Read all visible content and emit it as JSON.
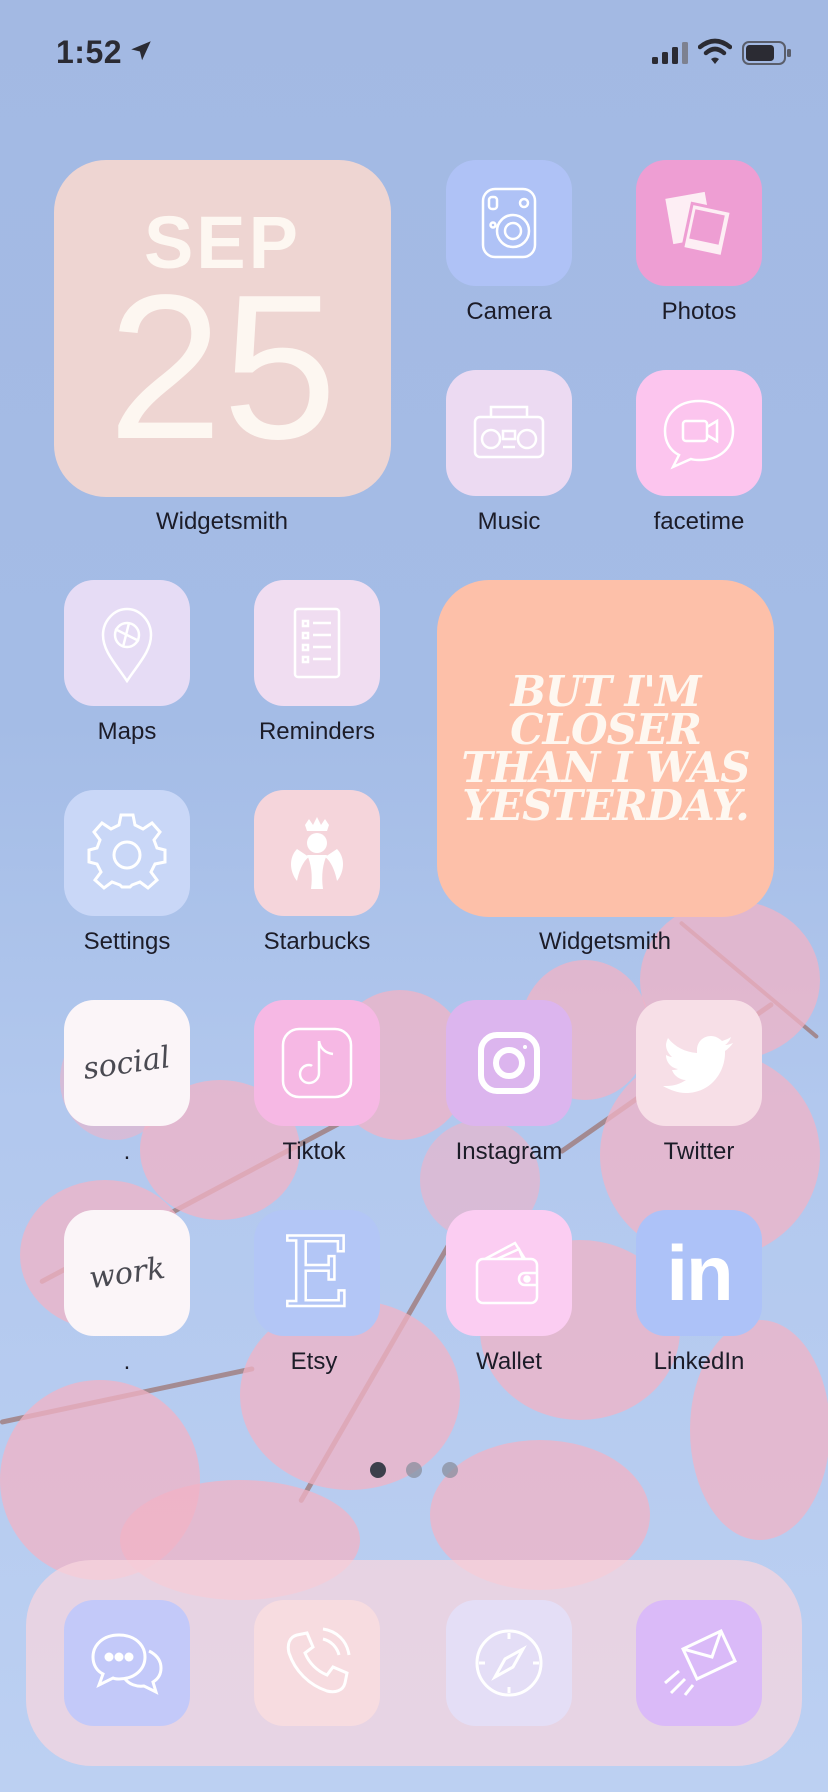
{
  "status_bar": {
    "time": "1:52"
  },
  "widgets": {
    "calendar": {
      "month": "SEP",
      "day": "25",
      "label": "Widgetsmith"
    },
    "quote": {
      "lines": [
        "BUT I'M",
        "CLOSER",
        "THAN I WAS",
        "YESTERDAY."
      ],
      "label": "Widgetsmith"
    }
  },
  "apps": {
    "camera": "Camera",
    "photos": "Photos",
    "music": "Music",
    "facetime": "facetime",
    "maps": "Maps",
    "reminders": "Reminders",
    "settings": "Settings",
    "starbucks": "Starbucks",
    "social": {
      "label": ".",
      "icon_text": "social"
    },
    "tiktok": "Tiktok",
    "instagram": "Instagram",
    "twitter": "Twitter",
    "work": {
      "label": ".",
      "icon_text": "work"
    },
    "etsy": {
      "label": "Etsy",
      "icon_text": "E"
    },
    "wallet": "Wallet",
    "linkedin": {
      "label": "LinkedIn",
      "icon_text": "in"
    }
  },
  "page_indicator": {
    "pages": 3,
    "current": 1
  },
  "dock": [
    "messages-icon",
    "phone-icon",
    "safari-icon",
    "mail-icon"
  ],
  "colors": {
    "sky": "#a3b9e3",
    "calendar_bg": "#eed5d2",
    "quote_bg": "#fdc0a9",
    "dock_bg": "#f8d6de",
    "label": "#1c1c28"
  }
}
